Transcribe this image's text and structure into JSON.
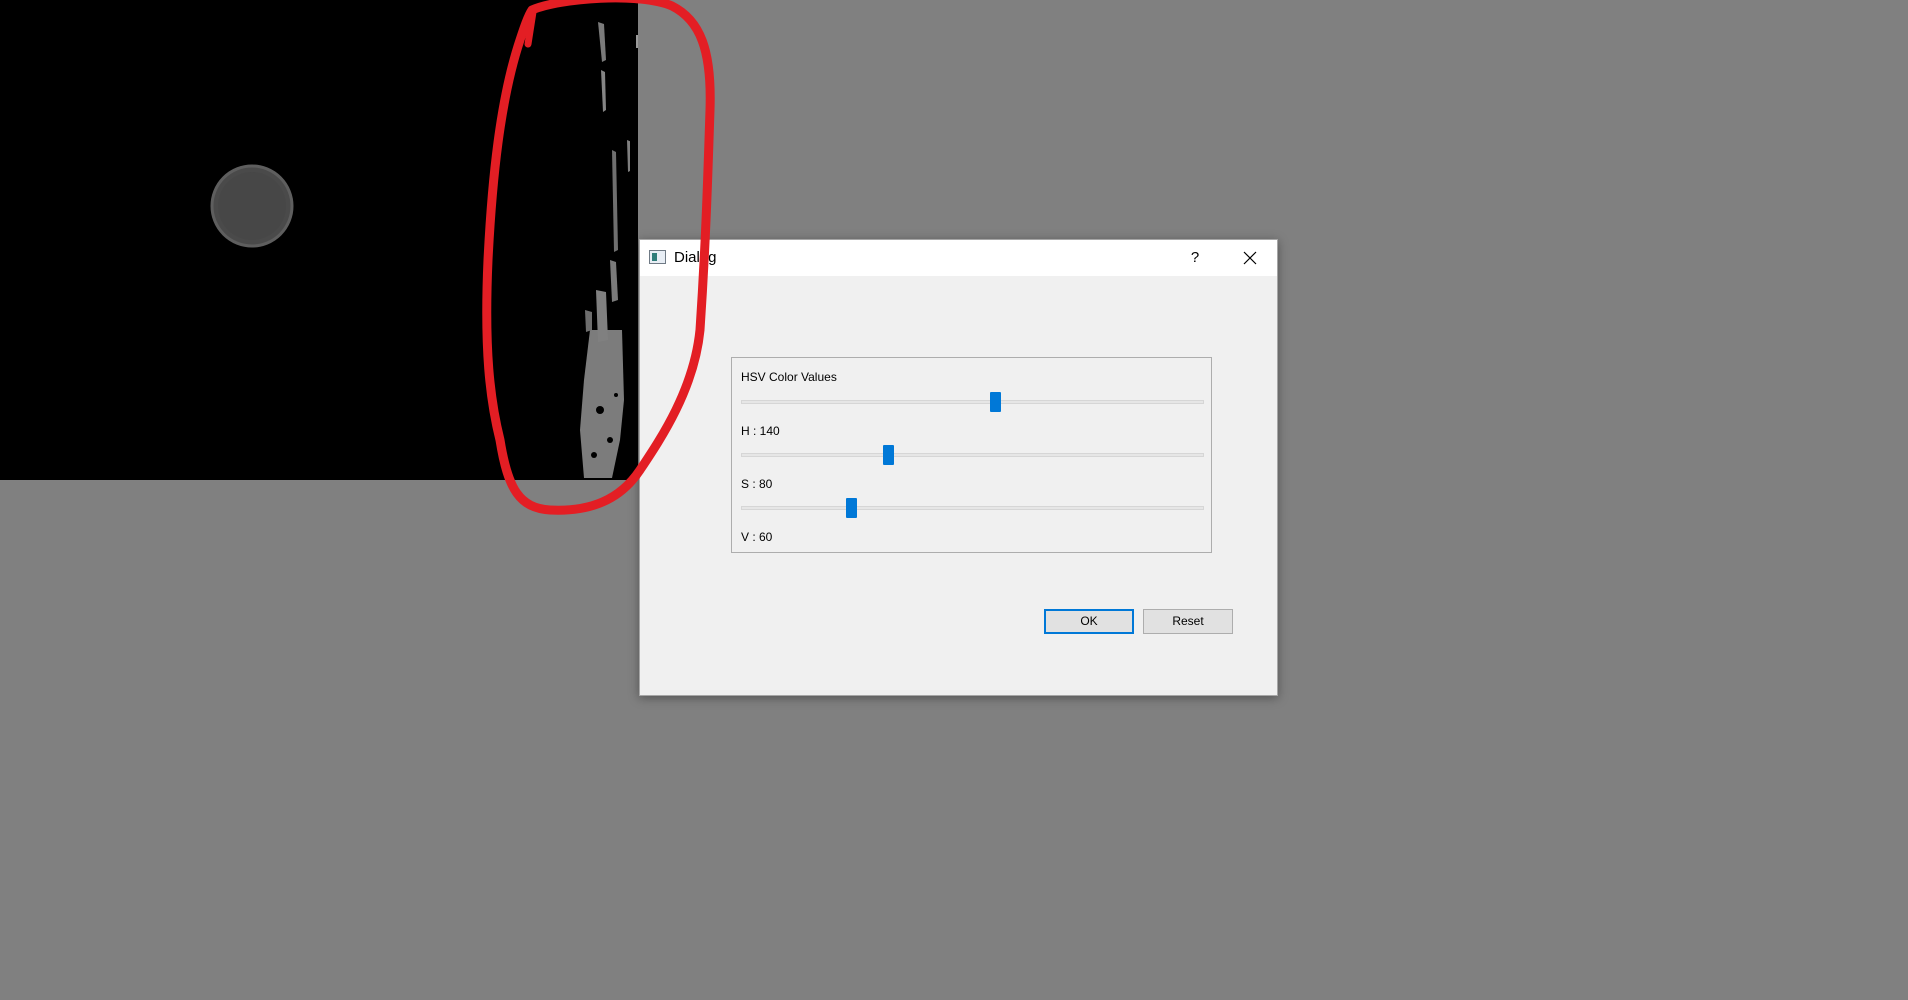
{
  "preview": {
    "background": "#000000",
    "blob_color": "#8a8a8a"
  },
  "dialog": {
    "title": "Dialog",
    "help_label": "?",
    "close_icon": "close-icon",
    "app_icon": "window-icon"
  },
  "hsv_group": {
    "title": "HSV Color Values",
    "sliders": [
      {
        "label": "H : 140",
        "position_fraction": 0.55,
        "thumb_color": "#0078d7"
      },
      {
        "label": "S : 80",
        "position_fraction": 0.32,
        "thumb_color": "#0078d7"
      },
      {
        "label": "V : 60",
        "position_fraction": 0.24,
        "thumb_color": "#0078d7"
      }
    ]
  },
  "buttons": {
    "ok_label": "OK",
    "reset_label": "Reset"
  },
  "annotation": {
    "color": "#e31e24"
  }
}
